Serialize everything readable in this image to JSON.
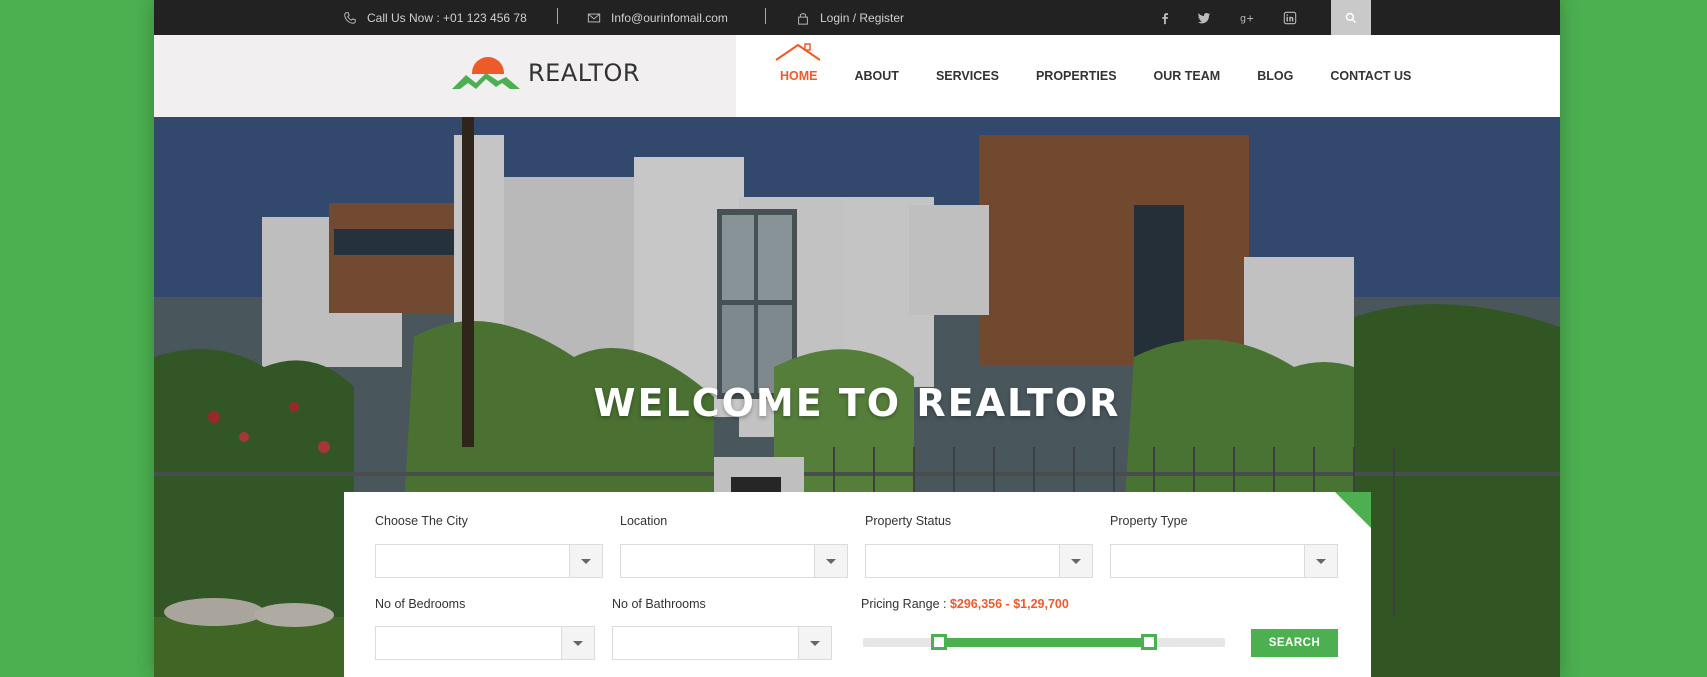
{
  "topbar": {
    "phone": "Call Us Now : +01 123 456 78",
    "email": "Info@ourinfomail.com",
    "login": "Login / Register",
    "social": [
      "facebook-icon",
      "twitter-icon",
      "google-plus-icon",
      "linkedin-icon"
    ]
  },
  "logo": {
    "text": "REALTOR"
  },
  "nav": {
    "items": [
      {
        "label": "HOME",
        "active": true
      },
      {
        "label": "ABOUT"
      },
      {
        "label": "SERVICES"
      },
      {
        "label": "PROPERTIES"
      },
      {
        "label": "OUR TEAM"
      },
      {
        "label": "BLOG"
      },
      {
        "label": "CONTACT US"
      }
    ]
  },
  "hero": {
    "title": "WELCOME TO REALTOR"
  },
  "search": {
    "city_label": "Choose The City",
    "location_label": "Location",
    "status_label": "Property Status",
    "type_label": "Property Type",
    "bedrooms_label": "No of Bedrooms",
    "bathrooms_label": "No of Bathrooms",
    "price_label": "Pricing Range :",
    "price_value": "$296,356 - $1,29,700",
    "price_slider": {
      "min_fraction": 0.21,
      "max_fraction": 0.79
    },
    "button_label": "SEARCH"
  },
  "colors": {
    "accent": "#ee5b2b",
    "green": "#4caf50",
    "topbar": "#222222"
  }
}
